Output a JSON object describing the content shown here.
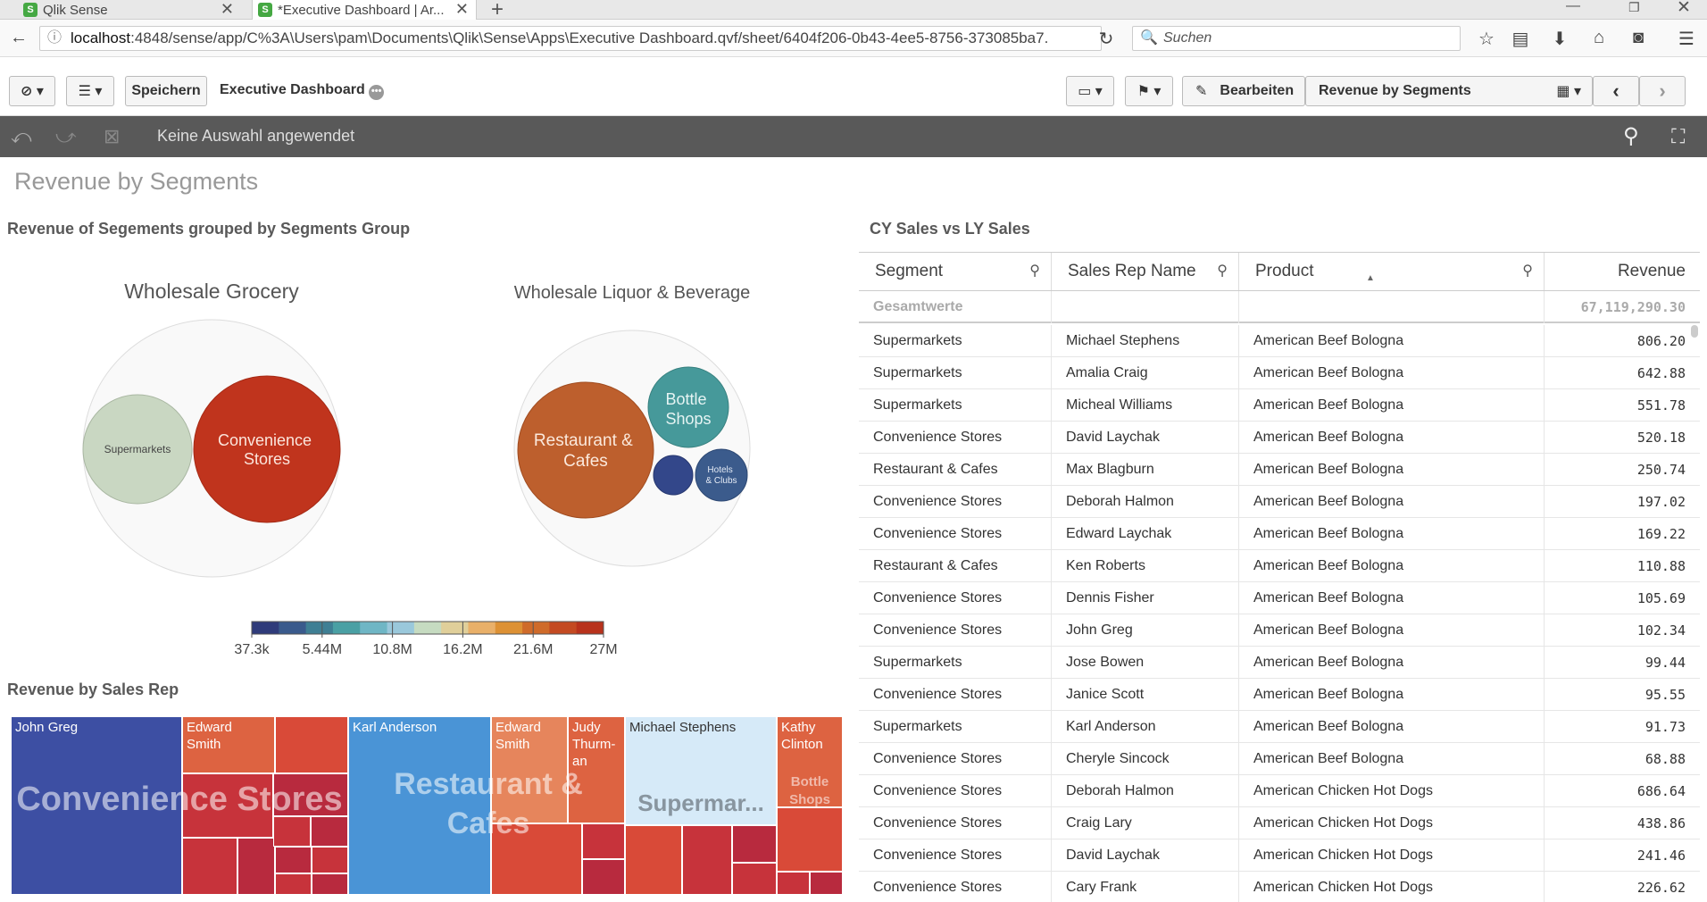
{
  "browser": {
    "tabs": [
      {
        "label": "Qlik Sense"
      },
      {
        "label": "*Executive Dashboard | Ar..."
      }
    ],
    "new_tab": "+",
    "url_host": "localhost",
    "url_rest": ":4848/sense/app/C%3A\\Users\\pam\\Documents\\Qlik\\Sense\\Apps\\Executive Dashboard.qvf/sheet/6404f206-0b43-4ee5-8756-373085ba7.",
    "search_placeholder": "Suchen"
  },
  "toolbar": {
    "save_label": "Speichern",
    "app_title": "Executive Dashboard",
    "edit_label": "Bearbeiten",
    "sheet_name": "Revenue by Segments"
  },
  "selections": {
    "status": "Keine Auswahl angewendet"
  },
  "sheet": {
    "title": "Revenue by Segments"
  },
  "bubble_chart": {
    "title": "Revenue of Segements grouped by Segments Group",
    "groups": [
      {
        "name": "Wholesale Grocery",
        "bubbles": [
          {
            "label": "Supermarkets",
            "color": "#c9d7c2"
          },
          {
            "label": "Convenience Stores",
            "color": "#c0341d"
          }
        ]
      },
      {
        "name": "Wholesale Liquor & Beverage",
        "bubbles": [
          {
            "label": "Restaurant & Cafes",
            "color": "#bd5f2d"
          },
          {
            "label": "Bottle Shops",
            "color": "#46999a"
          },
          {
            "label": "",
            "color": "#33478a"
          },
          {
            "label": "Hotels & Clubs",
            "color": "#3b5b8c"
          }
        ]
      }
    ],
    "legend": {
      "ticks": [
        "37.3k",
        "5.44M",
        "10.8M",
        "16.2M",
        "21.6M",
        "27M"
      ],
      "colors": [
        "#2f3b7a",
        "#3a5a8c",
        "#3f7f94",
        "#4aa0a4",
        "#6fb6c5",
        "#9ac8db",
        "#c6dbc1",
        "#e0cf9a",
        "#e9b069",
        "#dd9134",
        "#cf6b2a",
        "#c44a22",
        "#b8321c"
      ]
    }
  },
  "treemap": {
    "title": "Revenue by Sales Rep",
    "groups": [
      {
        "label": "Convenience Stores"
      },
      {
        "label": "Restaurant & Cafes"
      },
      {
        "label": "Supermar..."
      },
      {
        "label": "Bottle Shops"
      }
    ],
    "reps": {
      "john_greg": "John Greg",
      "edward_smith_1": "Edward Smith",
      "karl_anderson": "Karl Anderson",
      "edward_smith_2": "Edward Smith",
      "judy_thurman": "Judy Thurm-an",
      "michael_stephens": "Michael Stephens",
      "kathy_clinton": "Kathy Clinton"
    },
    "colors": {
      "navy": "#3d4fa3",
      "red": "#c7333b",
      "crimson": "#b82a3e",
      "orange": "#dd6341",
      "lightorange": "#e6855c",
      "blue": "#4a94d6",
      "pale": "#d6eaf8",
      "brightred": "#d94a38"
    }
  },
  "table": {
    "title": "CY Sales vs LY Sales",
    "headers": [
      "Segment",
      "Sales Rep Name",
      "Product",
      "Revenue"
    ],
    "total_label": "Gesamtwerte",
    "total_value": "67,119,290.30",
    "rows": [
      [
        "Supermarkets",
        "Michael Stephens",
        "American Beef Bologna",
        "806.20"
      ],
      [
        "Supermarkets",
        "Amalia Craig",
        "American Beef Bologna",
        "642.88"
      ],
      [
        "Supermarkets",
        "Micheal Williams",
        "American Beef Bologna",
        "551.78"
      ],
      [
        "Convenience Stores",
        "David Laychak",
        "American Beef Bologna",
        "520.18"
      ],
      [
        "Restaurant & Cafes",
        "Max Blagburn",
        "American Beef Bologna",
        "250.74"
      ],
      [
        "Convenience Stores",
        "Deborah Halmon",
        "American Beef Bologna",
        "197.02"
      ],
      [
        "Convenience Stores",
        "Edward Laychak",
        "American Beef Bologna",
        "169.22"
      ],
      [
        "Restaurant & Cafes",
        "Ken Roberts",
        "American Beef Bologna",
        "110.88"
      ],
      [
        "Convenience Stores",
        "Dennis Fisher",
        "American Beef Bologna",
        "105.69"
      ],
      [
        "Convenience Stores",
        "John Greg",
        "American Beef Bologna",
        "102.34"
      ],
      [
        "Supermarkets",
        "Jose Bowen",
        "American Beef Bologna",
        "99.44"
      ],
      [
        "Convenience Stores",
        "Janice Scott",
        "American Beef Bologna",
        "95.55"
      ],
      [
        "Supermarkets",
        "Karl Anderson",
        "American Beef Bologna",
        "91.73"
      ],
      [
        "Convenience Stores",
        "Cheryle Sincock",
        "American Beef Bologna",
        "68.88"
      ],
      [
        "Convenience Stores",
        "Deborah Halmon",
        "American Chicken Hot Dogs",
        "686.64"
      ],
      [
        "Convenience Stores",
        "Craig Lary",
        "American Chicken Hot Dogs",
        "438.86"
      ],
      [
        "Convenience Stores",
        "David Laychak",
        "American Chicken Hot Dogs",
        "241.46"
      ],
      [
        "Convenience Stores",
        "Cary Frank",
        "American Chicken Hot Dogs",
        "226.62"
      ]
    ]
  }
}
